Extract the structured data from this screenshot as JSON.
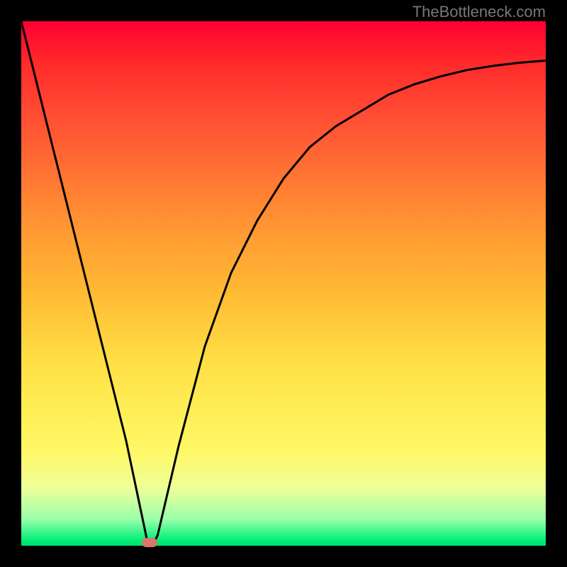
{
  "watermark": "TheBottleneck.com",
  "chart_data": {
    "type": "line",
    "title": "",
    "xlabel": "",
    "ylabel": "",
    "xlim": [
      0,
      100
    ],
    "ylim": [
      0,
      100
    ],
    "background_gradient": [
      "#ff0033",
      "#ff7733",
      "#ffdd44",
      "#eeff99",
      "#00e070"
    ],
    "series": [
      {
        "name": "bottleneck-curve",
        "x": [
          0,
          5,
          10,
          15,
          20,
          24,
          25,
          26,
          30,
          35,
          40,
          45,
          50,
          55,
          60,
          65,
          70,
          75,
          80,
          85,
          90,
          95,
          100
        ],
        "y": [
          100,
          80,
          60,
          40,
          20,
          1,
          0,
          2,
          19,
          38,
          52,
          62,
          70,
          76,
          80,
          83,
          86,
          88,
          89.5,
          90.7,
          91.5,
          92.1,
          92.5
        ]
      }
    ],
    "marker": {
      "x": 24.5,
      "y": 0.5,
      "color": "#d9776a"
    }
  }
}
